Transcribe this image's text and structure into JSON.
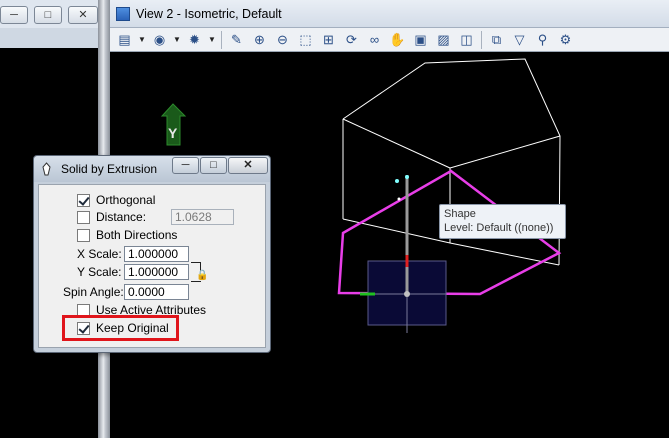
{
  "left_window": {
    "minimize_glyph": "─",
    "maximize_glyph": "□",
    "close_glyph": "✕"
  },
  "view": {
    "title": "View 2 - Isometric, Default",
    "toolbar_icons": [
      "view-attributes-icon",
      "dropdown-arrow-icon",
      "display-style-icon",
      "dropdown-arrow-icon",
      "lighting-icon",
      "dropdown-arrow-icon",
      "update-view-icon",
      "zoom-in-icon",
      "zoom-out-icon",
      "window-area-icon",
      "fit-view-icon",
      "rotate-view-icon",
      "walk-icon",
      "pan-view-icon",
      "previous-view-icon",
      "next-view-icon",
      "view-rotation-icon",
      "clip-volume-icon",
      "clip-mask-icon",
      "camera-icon"
    ],
    "tooltip": {
      "line1": "Shape",
      "line2": "Level: Default ((none))"
    },
    "axis_label": "Y"
  },
  "dialog": {
    "title": "Solid by Extrusion",
    "minimize_glyph": "─",
    "maximize_glyph": "□",
    "close_glyph": "✕",
    "orthogonal": {
      "label": "Orthogonal",
      "checked": true
    },
    "distance": {
      "label": "Distance:",
      "value": "1.0628",
      "checked": false
    },
    "both_directions": {
      "label": "Both Directions",
      "checked": false
    },
    "x_scale": {
      "label": "X Scale:",
      "value": "1.000000"
    },
    "y_scale": {
      "label": "Y Scale:",
      "value": "1.000000"
    },
    "spin_angle": {
      "label": "Spin Angle:",
      "value": "0.0000"
    },
    "use_active_attributes": {
      "label": "Use Active Attributes",
      "checked": false
    },
    "keep_original": {
      "label": "Keep Original",
      "checked": true
    }
  },
  "colors": {
    "shape_outline": "#e83ee8",
    "wireframe": "#ffffff",
    "highlight": "#e0151b",
    "axis_green": "#1a5a1a"
  }
}
